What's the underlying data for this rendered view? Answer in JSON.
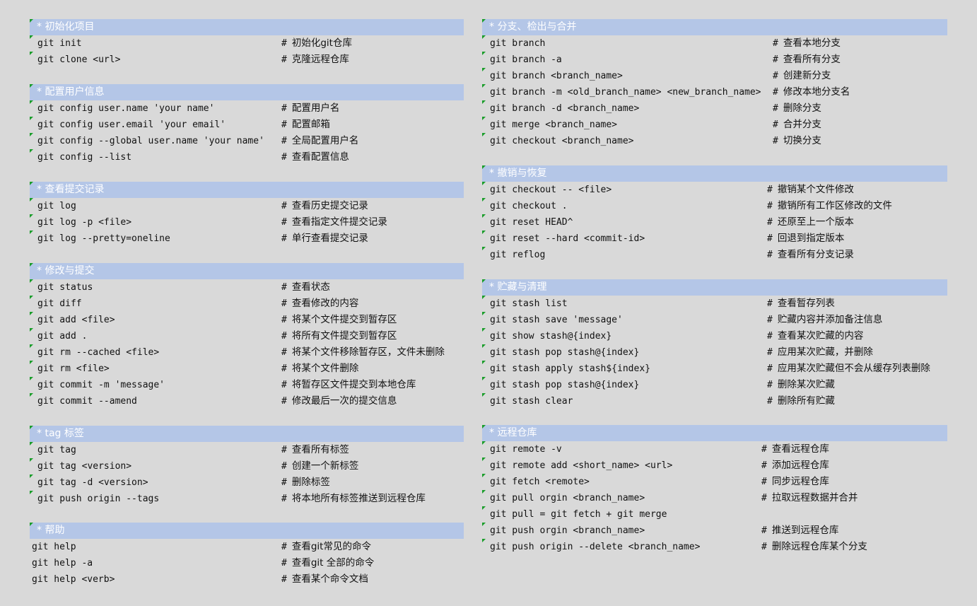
{
  "sections": [
    {
      "id": "init",
      "title": "* 初始化项目",
      "rows": [
        {
          "cmd": "git init",
          "desc": "初始化git仓库"
        },
        {
          "cmd": "git clone <url>",
          "desc": "克隆远程仓库"
        }
      ]
    },
    {
      "id": "config",
      "title": "* 配置用户信息",
      "rows": [
        {
          "cmd": "git config user.name 'your name'",
          "desc": "配置用户名"
        },
        {
          "cmd": "git config user.email 'your email'",
          "desc": "配置邮箱"
        },
        {
          "cmd": "git config --global user.name 'your name'",
          "desc": "全局配置用户名"
        },
        {
          "cmd": "git config --list",
          "desc": "查看配置信息"
        }
      ]
    },
    {
      "id": "log",
      "title": "* 查看提交记录",
      "rows": [
        {
          "cmd": "git log",
          "desc": "查看历史提交记录"
        },
        {
          "cmd": "git log -p <file>",
          "desc": "查看指定文件提交记录"
        },
        {
          "cmd": "git log --pretty=oneline",
          "desc": "单行查看提交记录"
        }
      ]
    },
    {
      "id": "modify",
      "title": "* 修改与提交",
      "rows": [
        {
          "cmd": "git status",
          "desc": "查看状态"
        },
        {
          "cmd": "git diff",
          "desc": "查看修改的内容"
        },
        {
          "cmd": "git add <file>",
          "desc": "将某个文件提交到暂存区"
        },
        {
          "cmd": "git add .",
          "desc": "将所有文件提交到暂存区"
        },
        {
          "cmd": "git rm --cached <file>",
          "desc": "将某个文件移除暂存区，文件未删除"
        },
        {
          "cmd": "git rm <file>",
          "desc": "将某个文件删除"
        },
        {
          "cmd": "git commit -m 'message'",
          "desc": "将暂存区文件提交到本地仓库"
        },
        {
          "cmd": "git commit --amend",
          "desc": "修改最后一次的提交信息"
        }
      ]
    },
    {
      "id": "tag",
      "title": "* tag 标签",
      "rows": [
        {
          "cmd": "git tag",
          "desc": "查看所有标签"
        },
        {
          "cmd": "git tag <version>",
          "desc": "创建一个新标签"
        },
        {
          "cmd": "git tag -d <version>",
          "desc": "删除标签"
        },
        {
          "cmd": "git push origin --tags",
          "desc": "将本地所有标签推送到远程仓库"
        }
      ]
    },
    {
      "id": "help",
      "title": "* 帮助",
      "rows": [
        {
          "cmd": "git help",
          "desc": "查看git常见的命令"
        },
        {
          "cmd": "git help -a",
          "desc": "查看git 全部的命令"
        },
        {
          "cmd": "git help <verb>",
          "desc": "查看某个命令文档"
        }
      ]
    },
    {
      "id": "branch",
      "title": "* 分支、检出与合并",
      "rows": [
        {
          "cmd": "git branch",
          "desc": "查看本地分支"
        },
        {
          "cmd": "git branch -a",
          "desc": "查看所有分支"
        },
        {
          "cmd": "git branch <branch_name>",
          "desc": "创建新分支"
        },
        {
          "cmd": "git branch -m <old_branch_name> <new_branch_name>",
          "desc": "修改本地分支名"
        },
        {
          "cmd": "git branch -d <branch_name>",
          "desc": "删除分支"
        },
        {
          "cmd": "git merge <branch_name>",
          "desc": "合并分支"
        },
        {
          "cmd": "git checkout <branch_name>",
          "desc": "切换分支"
        }
      ]
    },
    {
      "id": "undo",
      "title": "* 撤销与恢复",
      "rows": [
        {
          "cmd": "git checkout -- <file>",
          "desc": "撤销某个文件修改"
        },
        {
          "cmd": "git checkout .",
          "desc": "撤销所有工作区修改的文件"
        },
        {
          "cmd": "git reset HEAD^",
          "desc": "还原至上一个版本"
        },
        {
          "cmd": "git reset --hard <commit-id>",
          "desc": "回退到指定版本"
        },
        {
          "cmd": "git reflog",
          "desc": "查看所有分支记录"
        }
      ]
    },
    {
      "id": "stash",
      "title": "* 贮藏与清理",
      "rows": [
        {
          "cmd": "git stash list",
          "desc": "查看暂存列表"
        },
        {
          "cmd": "git stash save 'message'",
          "desc": "贮藏内容并添加备注信息"
        },
        {
          "cmd": "git show stash@{index}",
          "desc": "查看某次贮藏的内容"
        },
        {
          "cmd": "git stash pop stash@{index}",
          "desc": "应用某次贮藏，并删除"
        },
        {
          "cmd": "git stash apply stash${index}",
          "desc": "应用某次贮藏但不会从缓存列表删除"
        },
        {
          "cmd": "git stash pop stash@{index}",
          "desc": "删除某次贮藏"
        },
        {
          "cmd": "git stash clear",
          "desc": "删除所有贮藏"
        }
      ]
    },
    {
      "id": "remote",
      "title": "* 远程仓库",
      "rows": [
        {
          "cmd": "git remote -v",
          "desc": "查看远程仓库"
        },
        {
          "cmd": "git remote add <short_name> <url>",
          "desc": "添加远程仓库"
        },
        {
          "cmd": "git fetch <remote>",
          "desc": "同步远程仓库"
        },
        {
          "cmd": "git pull orgin <branch_name>",
          "desc": "拉取远程数据并合并"
        },
        {
          "cmd": "git pull = git fetch + git merge",
          "desc": ""
        },
        {
          "cmd": "git push orgin <branch_name>",
          "desc": "推送到远程仓库"
        },
        {
          "cmd": "git push origin --delete <branch_name>",
          "desc": "删除远程仓库某个分支"
        }
      ]
    }
  ]
}
